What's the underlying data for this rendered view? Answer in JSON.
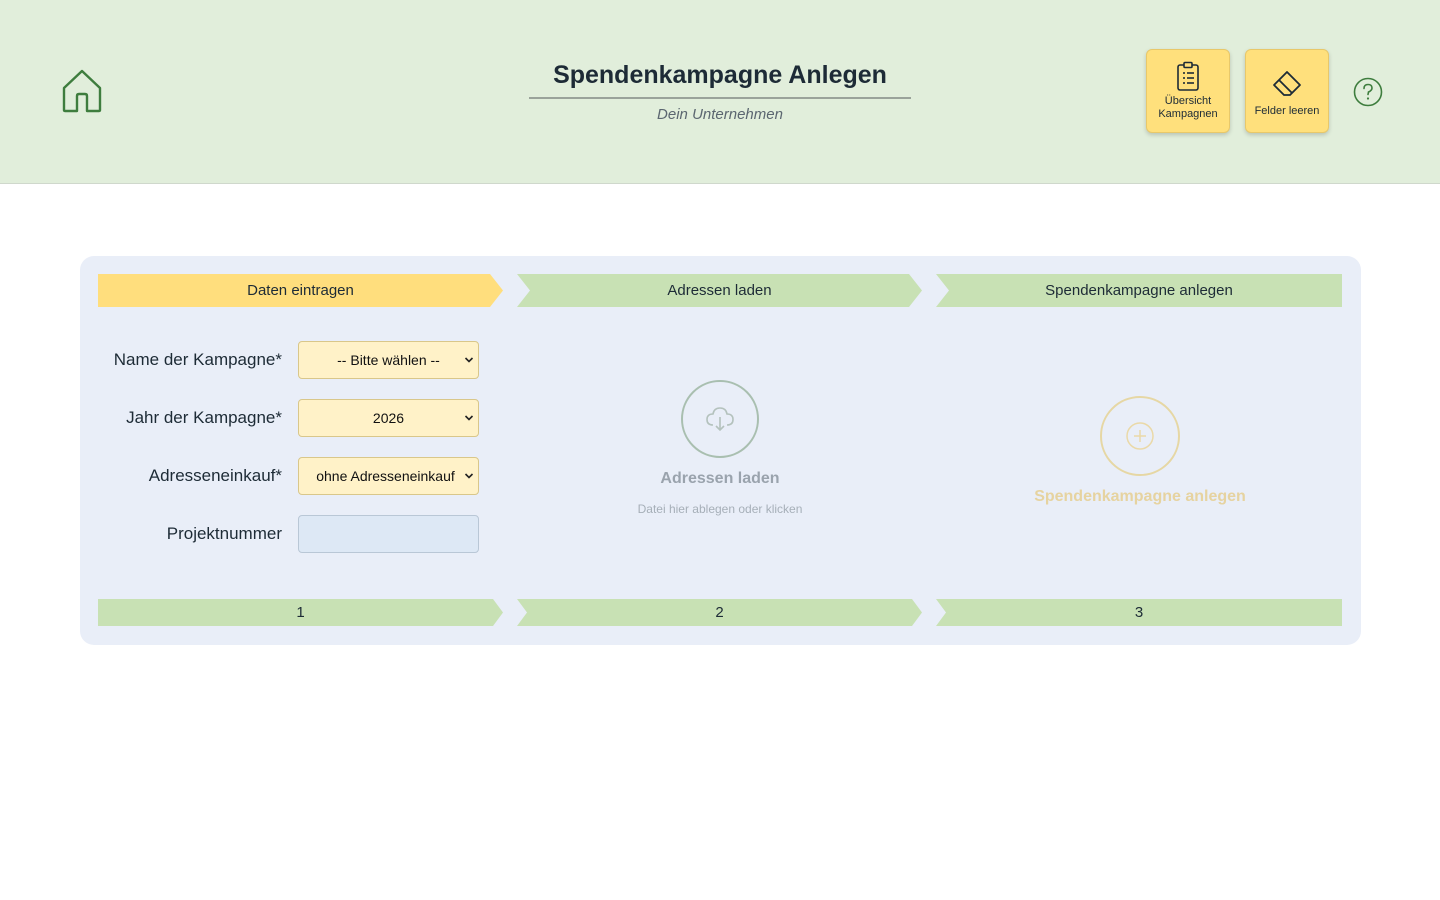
{
  "header": {
    "title": "Spendenkampagne Anlegen",
    "subtitle": "Dein Unternehmen",
    "buttons": {
      "overview_label_1": "Übersicht",
      "overview_label_2": "Kampagnen",
      "clear_label": "Felder leeren"
    },
    "icons": {
      "home": "home-icon",
      "overview": "clipboard-list-icon",
      "clear": "eraser-icon",
      "help": "question-circle-icon"
    }
  },
  "steps": [
    {
      "label": "Daten eintragen",
      "number": "1",
      "active": true
    },
    {
      "label": "Adressen laden",
      "number": "2",
      "active": false
    },
    {
      "label": "Spendenkampagne anlegen",
      "number": "3",
      "active": false
    }
  ],
  "form": {
    "campaign_name": {
      "label": "Name der Kampagne*",
      "value": "-- Bitte wählen --"
    },
    "campaign_year": {
      "label": "Jahr der Kampagne*",
      "value": "2026"
    },
    "address_purchase": {
      "label": "Adresseneinkauf*",
      "value": "ohne Adresseneinkauf"
    },
    "project_number": {
      "label": "Projektnummer",
      "value": ""
    }
  },
  "dropzone": {
    "title": "Adressen laden",
    "hint": "Datei hier ablegen oder klicken",
    "icon": "cloud-download-icon"
  },
  "create": {
    "title": "Spendenkampagne anlegen",
    "icon": "plus-circle-icon"
  },
  "colors": {
    "header_bg": "#e1eedb",
    "accent_yellow": "#ffde7d",
    "step_green": "#c8e1b4",
    "panel_bg": "#e9eef8"
  }
}
